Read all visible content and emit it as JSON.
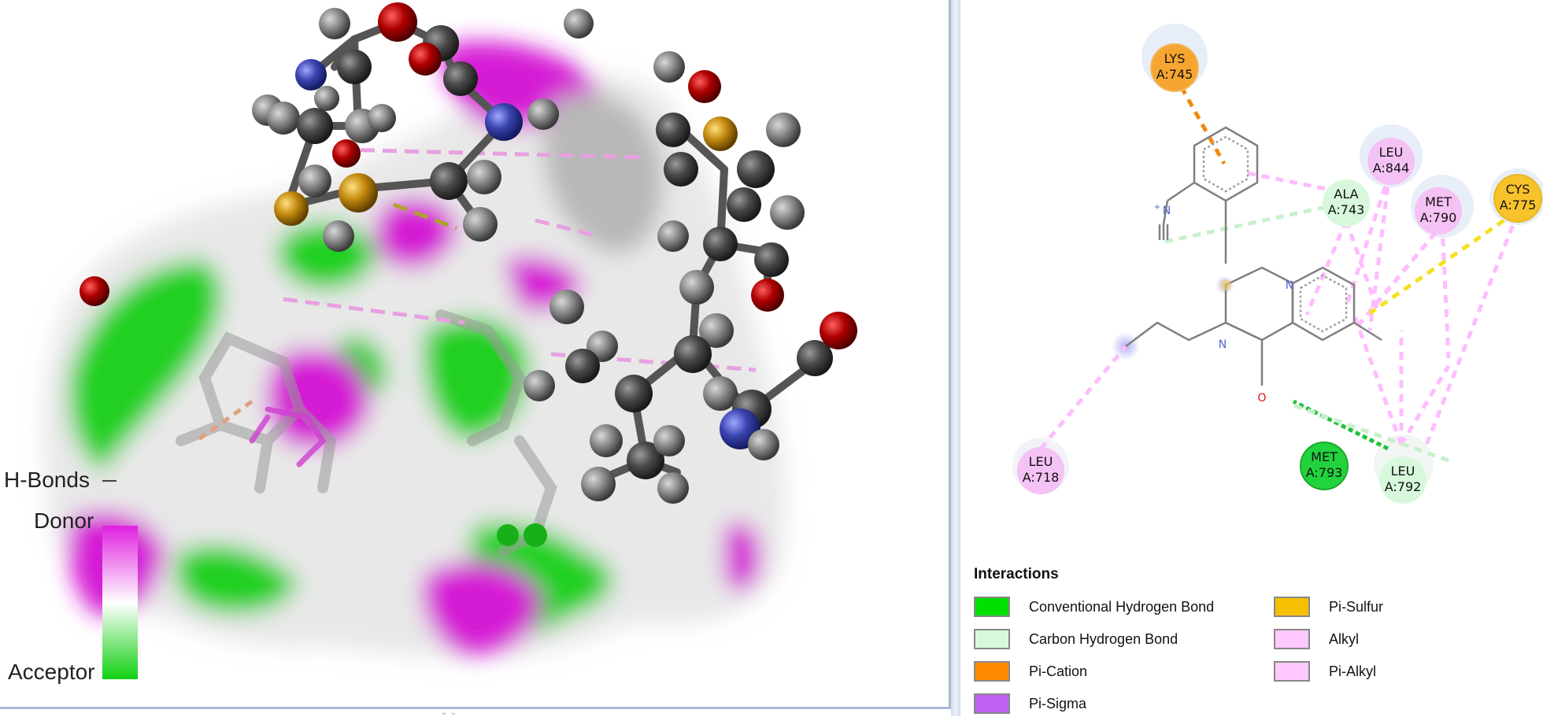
{
  "hbond_scale": {
    "title": "H-Bonds",
    "donor_label": "Donor",
    "acceptor_label": "Acceptor",
    "donor_color": "#e020e0",
    "acceptor_color": "#10d010"
  },
  "residues": [
    {
      "name": "LYS",
      "id": "A:745",
      "type": "pi-cation",
      "color": "#f5a530"
    },
    {
      "name": "LEU",
      "id": "A:844",
      "type": "pi-alkyl",
      "color": "#f5c2f5"
    },
    {
      "name": "ALA",
      "id": "A:743",
      "type": "carbon-hydrogen",
      "color": "#d8f8dc"
    },
    {
      "name": "MET",
      "id": "A:790",
      "type": "pi-alkyl",
      "color": "#f5c2f5"
    },
    {
      "name": "CYS",
      "id": "A:775",
      "type": "pi-sulfur",
      "color": "#f7c22a"
    },
    {
      "name": "LEU",
      "id": "A:718",
      "type": "alkyl",
      "color": "#f5c2f5"
    },
    {
      "name": "MET",
      "id": "A:793",
      "type": "conventional-hydrogen",
      "color": "#22d33e"
    },
    {
      "name": "LEU",
      "id": "A:792",
      "type": "carbon-hydrogen",
      "color": "#d8f8dc"
    }
  ],
  "atom_labels": {
    "n_top": "N",
    "n_bottom": "N",
    "o": "O",
    "nitrile_n": "N",
    "plus": "+"
  },
  "legend": {
    "title": "Interactions",
    "items": [
      {
        "label": "Conventional Hydrogen Bond",
        "color": "#00e000"
      },
      {
        "label": "Pi-Sulfur",
        "color": "#f5c000"
      },
      {
        "label": "Carbon Hydrogen Bond",
        "color": "#d8f8dc"
      },
      {
        "label": "Alkyl",
        "color": "#ffc8ff"
      },
      {
        "label": "Pi-Cation",
        "color": "#ff8a00"
      },
      {
        "label": "Pi-Alkyl",
        "color": "#ffc8ff"
      },
      {
        "label": "Pi-Sigma",
        "color": "#c060f0"
      }
    ]
  }
}
